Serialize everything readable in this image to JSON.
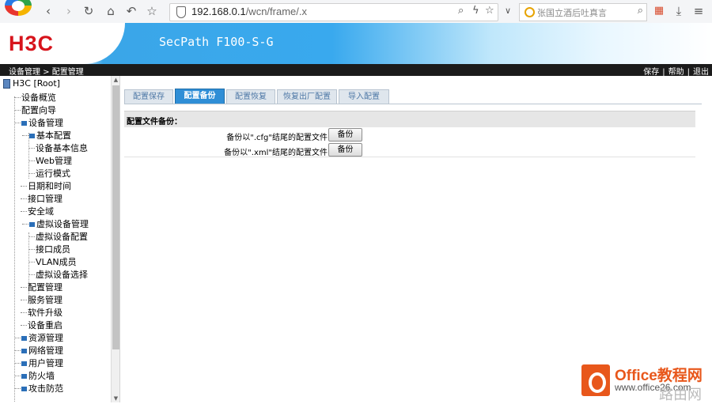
{
  "browser": {
    "url_host": "192.168.0.1",
    "url_path": "/wcn/frame/.x",
    "search_placeholder": "张国立酒后吐真言"
  },
  "banner": {
    "brand": "H3C",
    "product": "SecPath F100-S-G"
  },
  "navbar": {
    "breadcrumb": "设备管理 > 配置管理",
    "links": [
      "保存",
      "帮助",
      "退出"
    ],
    "separator": "|"
  },
  "sidebar": {
    "root": "H3C [Root]",
    "items": [
      {
        "label": "设备概览",
        "level": 1,
        "expandable": false
      },
      {
        "label": "配置向导",
        "level": 1,
        "expandable": false
      },
      {
        "label": "设备管理",
        "level": 1,
        "expandable": true
      },
      {
        "label": "基本配置",
        "level": 2,
        "expandable": true
      },
      {
        "label": "设备基本信息",
        "level": 3,
        "expandable": false
      },
      {
        "label": "Web管理",
        "level": 3,
        "expandable": false
      },
      {
        "label": "运行模式",
        "level": 3,
        "expandable": false
      },
      {
        "label": "日期和时间",
        "level": 2,
        "expandable": false
      },
      {
        "label": "接口管理",
        "level": 2,
        "expandable": false
      },
      {
        "label": "安全域",
        "level": 2,
        "expandable": false
      },
      {
        "label": "虚拟设备管理",
        "level": 2,
        "expandable": true
      },
      {
        "label": "虚拟设备配置",
        "level": 3,
        "expandable": false
      },
      {
        "label": "接口成员",
        "level": 3,
        "expandable": false
      },
      {
        "label": "VLAN成员",
        "level": 3,
        "expandable": false
      },
      {
        "label": "虚拟设备选择",
        "level": 3,
        "expandable": false
      },
      {
        "label": "配置管理",
        "level": 2,
        "expandable": false
      },
      {
        "label": "服务管理",
        "level": 2,
        "expandable": false
      },
      {
        "label": "软件升级",
        "level": 2,
        "expandable": false
      },
      {
        "label": "设备重启",
        "level": 2,
        "expandable": false
      },
      {
        "label": "资源管理",
        "level": 1,
        "expandable": true
      },
      {
        "label": "网络管理",
        "level": 1,
        "expandable": true
      },
      {
        "label": "用户管理",
        "level": 1,
        "expandable": true
      },
      {
        "label": "防火墙",
        "level": 1,
        "expandable": true
      },
      {
        "label": "攻击防范",
        "level": 1,
        "expandable": true
      }
    ]
  },
  "tabs": [
    {
      "label": "配置保存",
      "active": false
    },
    {
      "label": "配置备份",
      "active": true
    },
    {
      "label": "配置恢复",
      "active": false
    },
    {
      "label": "恢复出厂配置",
      "active": false
    },
    {
      "label": "导入配置",
      "active": false
    }
  ],
  "content": {
    "section_title": "配置文件备份：",
    "rows": [
      {
        "label": "备份以\".cfg\"结尾的配置文件",
        "button": "备份"
      },
      {
        "label": "备份以\".xml\"结尾的配置文件",
        "button": "备份"
      }
    ]
  },
  "watermark": {
    "brand": "Office教程网",
    "url": "www.office26.com",
    "extra": "路由网"
  }
}
